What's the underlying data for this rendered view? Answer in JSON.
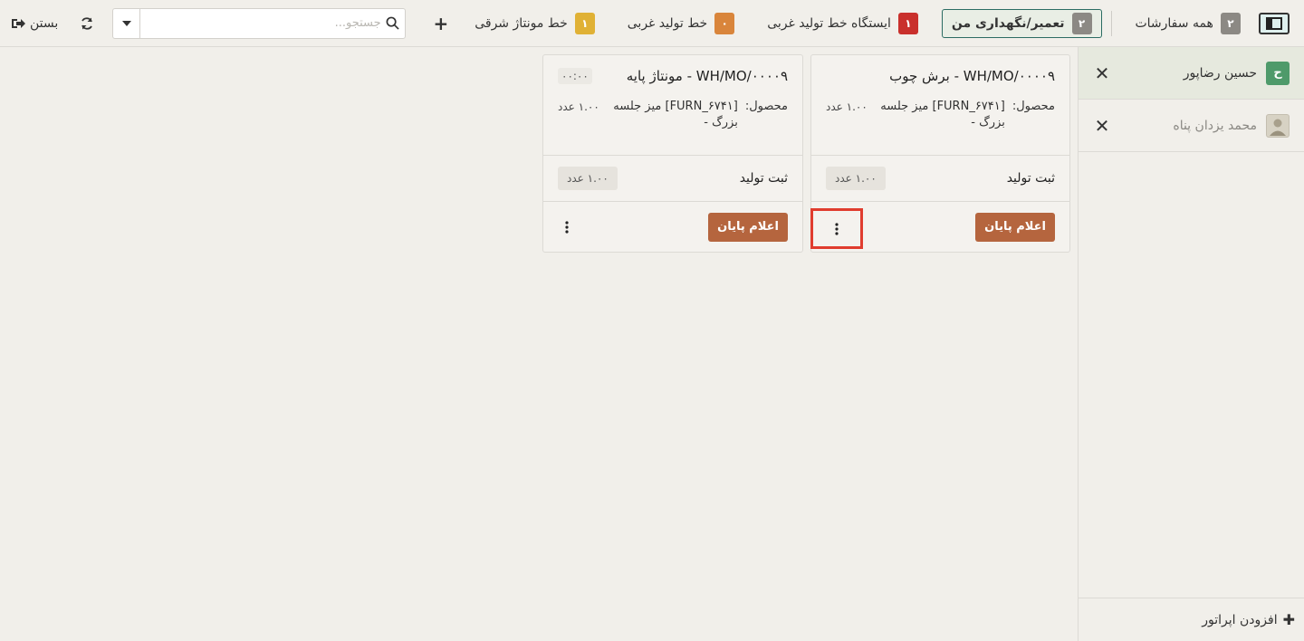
{
  "topbar": {
    "tabs": [
      {
        "label": "همه سفارشات",
        "badge": "۲",
        "badge_color": "#8c8984",
        "active": false
      },
      {
        "label": "تعمیر/نگهداری من",
        "badge": "۲",
        "badge_color": "#8c8984",
        "active": true
      },
      {
        "label": "ایستگاه خط تولید غربی",
        "badge": "۱",
        "badge_color": "#c9302c",
        "active": false
      },
      {
        "label": "خط تولید غربی",
        "badge": "۰",
        "badge_color": "#d9853b",
        "active": false
      },
      {
        "label": "خط مونتاژ شرقی",
        "badge": "۱",
        "badge_color": "#e0b135",
        "active": false
      }
    ],
    "search_placeholder": "جستجو...",
    "close_label": "بستن"
  },
  "operators": [
    {
      "name": "حسین رضاپور",
      "initial": "ح",
      "avatar_color": "#4e9a6a",
      "active": true
    },
    {
      "name": "محمد یزدان پناه",
      "initial": "",
      "avatar_color": "#c9c3b3",
      "active": false
    }
  ],
  "add_operator_label": "افزودن اپراتور",
  "cards": [
    {
      "title": "WH/MO/۰۰۰۰۹ - برش چوب",
      "timer": "",
      "product_label": "محصول:",
      "product_name": "[FURN_۶۷۴۱] میز جلسه بزرگ -",
      "product_qty": "۱.۰۰ عدد",
      "step_label": "ثبت تولید",
      "step_qty": "۱.۰۰ عدد",
      "finish_label": "اعلام پایان"
    },
    {
      "title": "WH/MO/۰۰۰۰۹ - مونتاژ پایه",
      "timer": "۰۰:۰۰",
      "product_label": "محصول:",
      "product_name": "[FURN_۶۷۴۱] میز جلسه بزرگ -",
      "product_qty": "۱.۰۰ عدد",
      "step_label": "ثبت تولید",
      "step_qty": "۱.۰۰ عدد",
      "finish_label": "اعلام پایان"
    }
  ]
}
